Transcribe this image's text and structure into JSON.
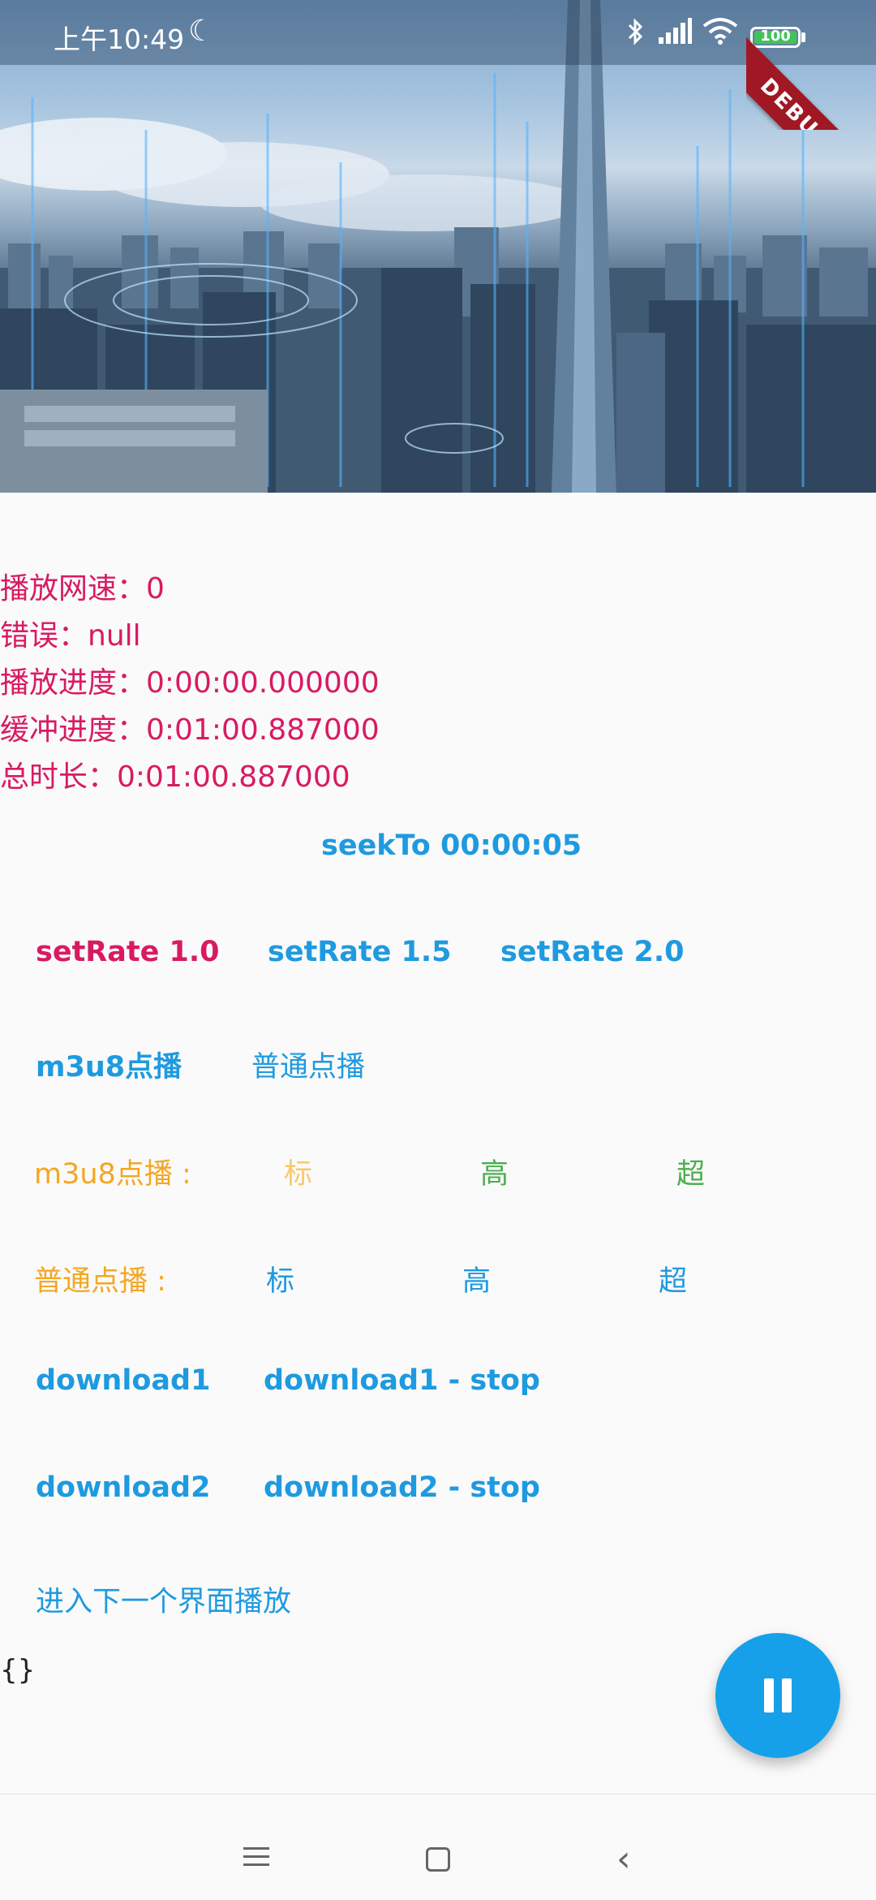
{
  "status_bar": {
    "time": "上午10:49",
    "battery": "100",
    "debug_label": "DEBUG"
  },
  "info": {
    "speed": "播放网速：0",
    "error": "错误：null",
    "progress": "播放进度：0:00:00.000000",
    "buffer": "缓冲进度：0:01:00.887000",
    "duration": "总时长：0:01:00.887000"
  },
  "controls": {
    "seek": "seekTo 00:00:05",
    "rate_1": "setRate 1.0",
    "rate_1_5": "setRate 1.5",
    "rate_2": "setRate 2.0",
    "m3u8_vod": "m3u8点播",
    "normal_vod": "普通点播",
    "m3u8_quality_label": "m3u8点播 :",
    "m3u8_standard": "标",
    "m3u8_high": "高",
    "m3u8_super": "超",
    "normal_quality_label": "普通点播 :",
    "normal_standard": "标",
    "normal_high": "高",
    "normal_super": "超",
    "download1": "download1",
    "download1_stop": "download1 - stop",
    "download2": "download2",
    "download2_stop": "download2 - stop",
    "next_page": "进入下一个界面播放",
    "braces": "{}"
  },
  "colors": {
    "accent": "#1e9ae0",
    "pink": "#d81b60",
    "orange": "#f5a623",
    "green": "#4caf50"
  },
  "icons": {
    "fab": "pause-icon",
    "nav": [
      "menu-icon",
      "home-icon",
      "back-icon"
    ]
  }
}
